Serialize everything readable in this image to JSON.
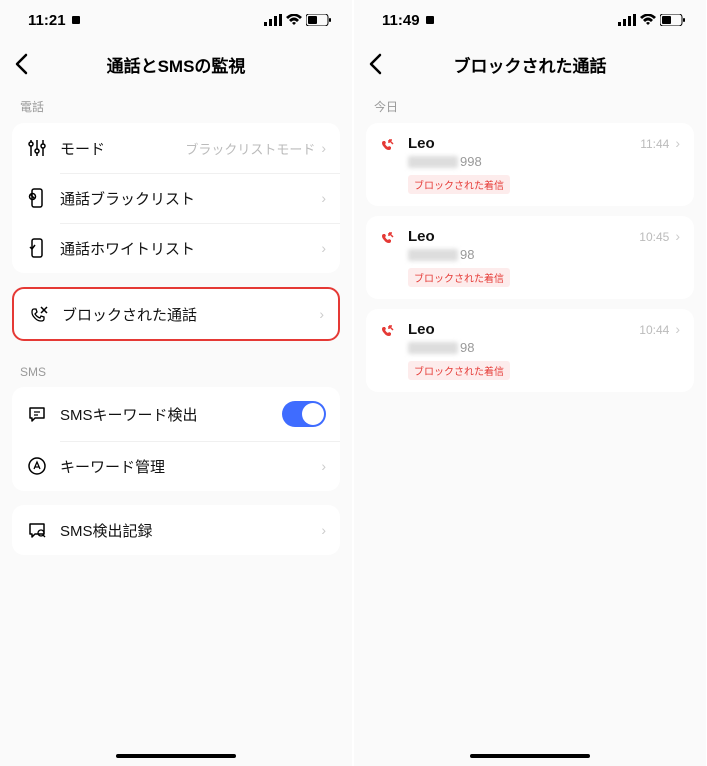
{
  "left": {
    "statusbar": {
      "time": "11:21"
    },
    "header": {
      "title": "通話とSMSの監視"
    },
    "sections": {
      "phone": {
        "label": "電話",
        "mode": {
          "label": "モード",
          "value": "ブラックリストモード"
        },
        "blacklist": {
          "label": "通話ブラックリスト"
        },
        "whitelist": {
          "label": "通話ホワイトリスト"
        },
        "blocked": {
          "label": "ブロックされた通話"
        }
      },
      "sms": {
        "label": "SMS",
        "keyword": {
          "label": "SMSキーワード検出"
        },
        "manage": {
          "label": "キーワード管理"
        },
        "log": {
          "label": "SMS検出記録"
        }
      }
    }
  },
  "right": {
    "statusbar": {
      "time": "11:49"
    },
    "header": {
      "title": "ブロックされた通話"
    },
    "section_label": "今日",
    "calls": [
      {
        "name": "Leo",
        "num_suffix": "998",
        "status": "ブロックされた着信",
        "time": "11:44"
      },
      {
        "name": "Leo",
        "num_suffix": "98",
        "status": "ブロックされた着信",
        "time": "10:45"
      },
      {
        "name": "Leo",
        "num_suffix": "98",
        "status": "ブロックされた着信",
        "time": "10:44"
      }
    ]
  }
}
